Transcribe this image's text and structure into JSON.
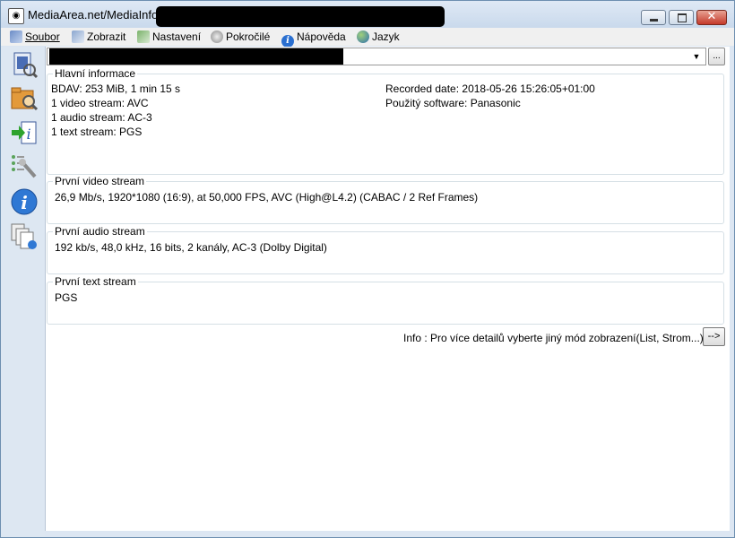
{
  "window": {
    "title": "MediaArea.net/MediaInfo -",
    "app_icon": "speaker-waves-icon"
  },
  "menu": {
    "items": [
      {
        "label": "Soubor",
        "icon": "open-file-icon"
      },
      {
        "label": "Zobrazit",
        "icon": "view-icon"
      },
      {
        "label": "Nastavení",
        "icon": "settings-icon"
      },
      {
        "label": "Pokročilé",
        "icon": "advanced-icon"
      },
      {
        "label": "Nápověda",
        "icon": "help-info-icon"
      },
      {
        "label": "Jazyk",
        "icon": "globe-icon"
      }
    ]
  },
  "sidebar": {
    "icons": [
      "open-file-icon",
      "open-folder-icon",
      "export-icon",
      "preferences-icon",
      "about-info-icon",
      "copy-clipboard-icon"
    ]
  },
  "file_selector": {
    "dots_label": "...",
    "arrow_label": "▼"
  },
  "sections": {
    "general": {
      "legend": "Hlavní informace",
      "left": [
        "BDAV: 253 MiB, 1 min 15 s",
        "1 video stream: AVC",
        "1 audio stream: AC-3",
        "1 text stream: PGS"
      ],
      "right": [
        "Recorded date: 2018-05-26 15:26:05+01:00",
        "Použitý software: Panasonic"
      ]
    },
    "video": {
      "legend": "První video stream",
      "text": "26,9 Mb/s, 1920*1080 (16:9), at 50,000 FPS, AVC (High@L4.2) (CABAC / 2 Ref Frames)"
    },
    "audio": {
      "legend": "První audio stream",
      "text": "192 kb/s, 48,0 kHz, 16 bits, 2 kanály, AC-3 (Dolby Digital)"
    },
    "text": {
      "legend": "První text stream",
      "text": "PGS"
    }
  },
  "footer": {
    "info": "Info : Pro více detailů vyberte jiný mód zobrazení(List, Strom...)",
    "next_label": "-->"
  },
  "colors": {
    "title_gradient_top": "#dfe9f5",
    "close_button": "#c4392a",
    "sidebar_bg": "#dde7f2",
    "group_border": "#d5dfe5"
  }
}
